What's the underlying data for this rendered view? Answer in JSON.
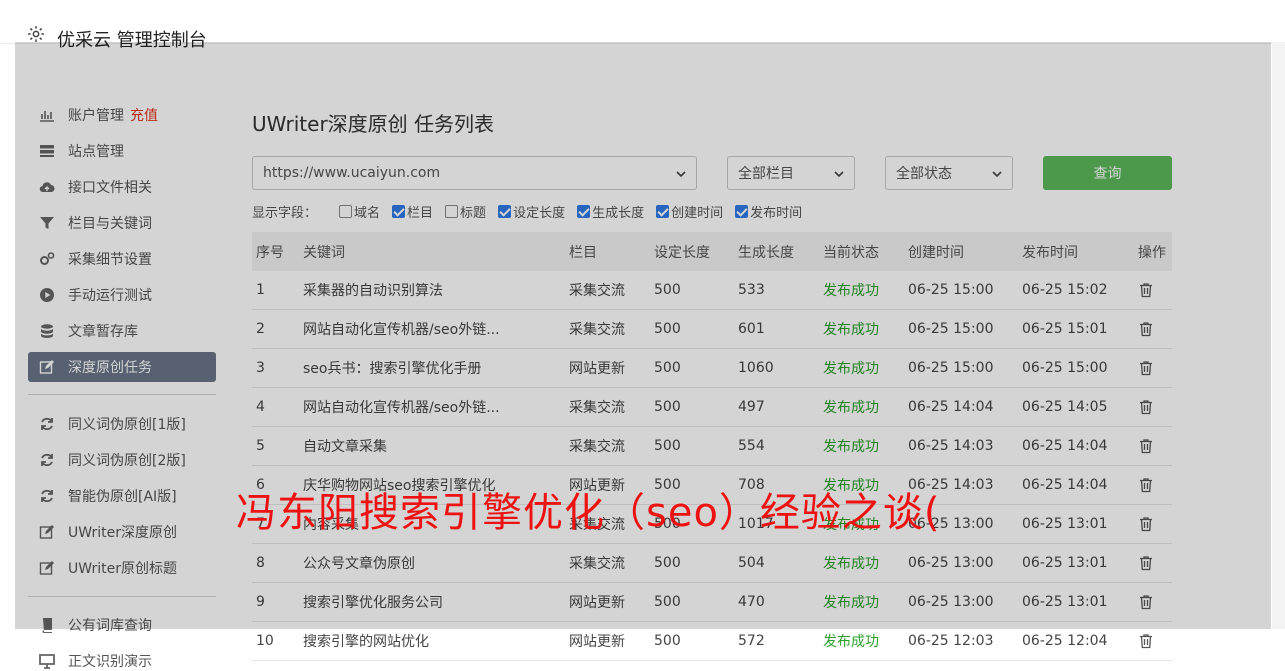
{
  "header": {
    "title": "优采云 管理控制台"
  },
  "sidebar": {
    "items": [
      {
        "label": "账户管理",
        "tag": "充值",
        "icon": "bar-chart-icon"
      },
      {
        "label": "站点管理",
        "icon": "server-icon"
      },
      {
        "label": "接口文件相关",
        "icon": "cloud-upload-icon"
      },
      {
        "label": "栏目与关键词",
        "icon": "filter-icon"
      },
      {
        "label": "采集细节设置",
        "icon": "gears-icon"
      },
      {
        "label": "手动运行测试",
        "icon": "play-circle-icon"
      },
      {
        "label": "文章暂存库",
        "icon": "database-icon"
      },
      {
        "label": "深度原创任务",
        "icon": "edit-icon",
        "active": true
      },
      {
        "label": "同义词伪原创[1版]",
        "icon": "refresh-icon"
      },
      {
        "label": "同义词伪原创[2版]",
        "icon": "refresh-icon"
      },
      {
        "label": "智能伪原创[AI版]",
        "icon": "refresh-icon"
      },
      {
        "label": "UWriter深度原创",
        "icon": "edit-icon"
      },
      {
        "label": "UWriter原创标题",
        "icon": "edit-icon"
      },
      {
        "label": "公有词库查询",
        "icon": "book-icon"
      },
      {
        "label": "正文识别演示",
        "icon": "monitor-icon"
      }
    ]
  },
  "main": {
    "title": "UWriter深度原创 任务列表",
    "filters": {
      "site": "https://www.ucaiyun.com",
      "column": "全部栏目",
      "status": "全部状态",
      "query_label": "查询"
    },
    "fields_label": "显示字段：",
    "fields": [
      {
        "label": "域名",
        "checked": false
      },
      {
        "label": "栏目",
        "checked": true
      },
      {
        "label": "标题",
        "checked": false
      },
      {
        "label": "设定长度",
        "checked": true
      },
      {
        "label": "生成长度",
        "checked": true
      },
      {
        "label": "创建时间",
        "checked": true
      },
      {
        "label": "发布时间",
        "checked": true
      }
    ],
    "table": {
      "headers": [
        "序号",
        "关键词",
        "栏目",
        "设定长度",
        "生成长度",
        "当前状态",
        "创建时间",
        "发布时间",
        "操作"
      ],
      "rows": [
        [
          "1",
          "采集器的自动识别算法",
          "采集交流",
          "500",
          "533",
          "发布成功",
          "06-25 15:00",
          "06-25 15:02"
        ],
        [
          "2",
          "网站自动化宣传机器/seo外链...",
          "采集交流",
          "500",
          "601",
          "发布成功",
          "06-25 15:00",
          "06-25 15:01"
        ],
        [
          "3",
          "seo兵书：搜索引擎优化手册",
          "网站更新",
          "500",
          "1060",
          "发布成功",
          "06-25 15:00",
          "06-25 15:00"
        ],
        [
          "4",
          "网站自动化宣传机器/seo外链...",
          "采集交流",
          "500",
          "497",
          "发布成功",
          "06-25 14:04",
          "06-25 14:05"
        ],
        [
          "5",
          "自动文章采集",
          "采集交流",
          "500",
          "554",
          "发布成功",
          "06-25 14:03",
          "06-25 14:04"
        ],
        [
          "6",
          "庆华购物网站seo搜索引擎优化",
          "网站更新",
          "500",
          "708",
          "发布成功",
          "06-25 14:03",
          "06-25 14:04"
        ],
        [
          "7",
          "内容采集",
          "采集交流",
          "500",
          "1017",
          "发布成功",
          "06-25 13:00",
          "06-25 13:01"
        ],
        [
          "8",
          "公众号文章伪原创",
          "采集交流",
          "500",
          "504",
          "发布成功",
          "06-25 13:00",
          "06-25 13:01"
        ],
        [
          "9",
          "搜索引擎优化服务公司",
          "网站更新",
          "500",
          "470",
          "发布成功",
          "06-25 13:00",
          "06-25 13:01"
        ],
        [
          "10",
          "搜索引擎的网站优化",
          "网站更新",
          "500",
          "572",
          "发布成功",
          "06-25 12:03",
          "06-25 12:04"
        ]
      ]
    }
  },
  "banner": {
    "text": "冯东阳搜索引擎优化（seo）经验之谈("
  },
  "colors": {
    "accent": "#5cb85c",
    "active_nav": "#697588",
    "status_ok": "#2aa02a",
    "banner": "#ee1111",
    "tag": "#e0341e"
  }
}
